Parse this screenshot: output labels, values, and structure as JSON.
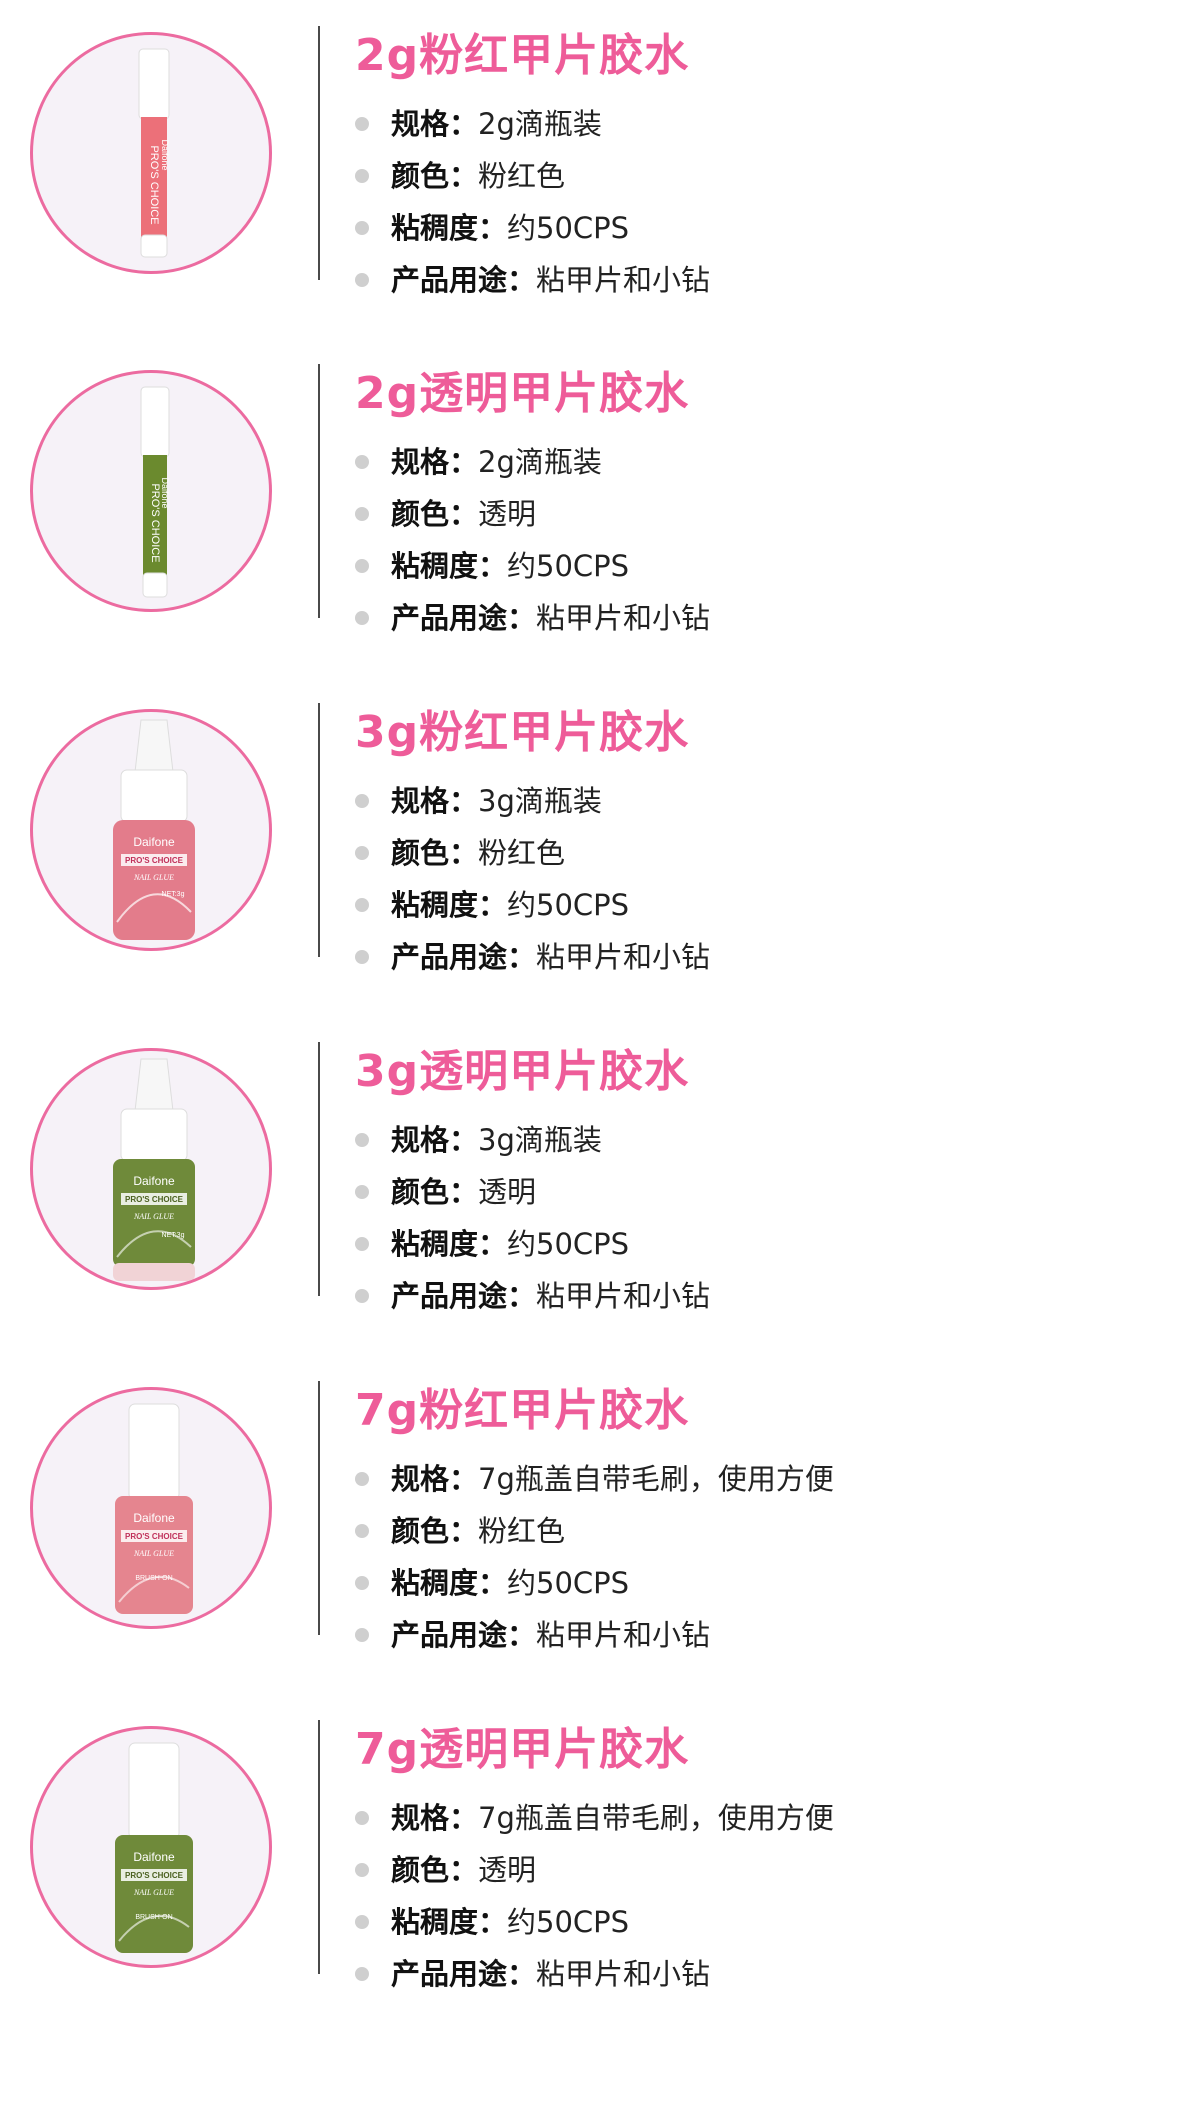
{
  "accent_color": "#ee5c99",
  "circle_border_color": "#ec6ba0",
  "products": [
    {
      "title": "2g粉红甲片胶水",
      "image_icon": "pink-pen-glue",
      "brand_on_pack": "Daifone",
      "pack_text": "PRO'S CHOICE",
      "specs": [
        {
          "label": "规格：",
          "value": "2g滴瓶装"
        },
        {
          "label": "颜色：",
          "value": "粉红色"
        },
        {
          "label": "粘稠度：",
          "value": "约50CPS"
        },
        {
          "label": "产品用途：",
          "value": "粘甲片和小钻"
        }
      ]
    },
    {
      "title": "2g透明甲片胶水",
      "image_icon": "green-pen-glue",
      "brand_on_pack": "Daifone",
      "pack_text": "PRO'S CHOICE",
      "specs": [
        {
          "label": "规格：",
          "value": "2g滴瓶装"
        },
        {
          "label": "颜色：",
          "value": "透明"
        },
        {
          "label": "粘稠度：",
          "value": "约50CPS"
        },
        {
          "label": "产品用途：",
          "value": "粘甲片和小钻"
        }
      ]
    },
    {
      "title": "3g粉红甲片胶水",
      "image_icon": "pink-dropper-bottle",
      "brand_on_pack": "Daifone",
      "pack_text": "PRO'S CHOICE",
      "pack_text_2": "NAIL GLUE",
      "pack_text_3": "NET:3g",
      "specs": [
        {
          "label": "规格：",
          "value": "3g滴瓶装"
        },
        {
          "label": "颜色：",
          "value": "粉红色"
        },
        {
          "label": "粘稠度：",
          "value": "约50CPS"
        },
        {
          "label": "产品用途：",
          "value": "粘甲片和小钻"
        }
      ]
    },
    {
      "title": "3g透明甲片胶水",
      "image_icon": "green-dropper-bottle",
      "brand_on_pack": "Daifone",
      "pack_text": "PRO'S CHOICE",
      "pack_text_2": "NAIL GLUE",
      "pack_text_3": "NET:3g",
      "specs": [
        {
          "label": "规格：",
          "value": "3g滴瓶装"
        },
        {
          "label": "颜色：",
          "value": "透明"
        },
        {
          "label": "粘稠度：",
          "value": "约50CPS"
        },
        {
          "label": "产品用途：",
          "value": "粘甲片和小钻"
        }
      ]
    },
    {
      "title": "7g粉红甲片胶水",
      "image_icon": "pink-brush-bottle",
      "brand_on_pack": "Daifone",
      "pack_text": "PRO'S CHOICE",
      "pack_text_2": "NAIL GLUE",
      "pack_text_3": "BRUSH-ON",
      "specs": [
        {
          "label": "规格：",
          "value": "7g瓶盖自带毛刷，使用方便"
        },
        {
          "label": "颜色：",
          "value": "粉红色"
        },
        {
          "label": "粘稠度：",
          "value": "约50CPS"
        },
        {
          "label": "产品用途：",
          "value": "粘甲片和小钻"
        }
      ]
    },
    {
      "title": "7g透明甲片胶水",
      "image_icon": "green-brush-bottle",
      "brand_on_pack": "Daifone",
      "pack_text": "PRO'S CHOICE",
      "pack_text_2": "NAIL GLUE",
      "pack_text_3": "BRUSH-ON",
      "specs": [
        {
          "label": "规格：",
          "value": "7g瓶盖自带毛刷，使用方便"
        },
        {
          "label": "颜色：",
          "value": "透明"
        },
        {
          "label": "粘稠度：",
          "value": "约50CPS"
        },
        {
          "label": "产品用途：",
          "value": "粘甲片和小钻"
        }
      ]
    }
  ]
}
